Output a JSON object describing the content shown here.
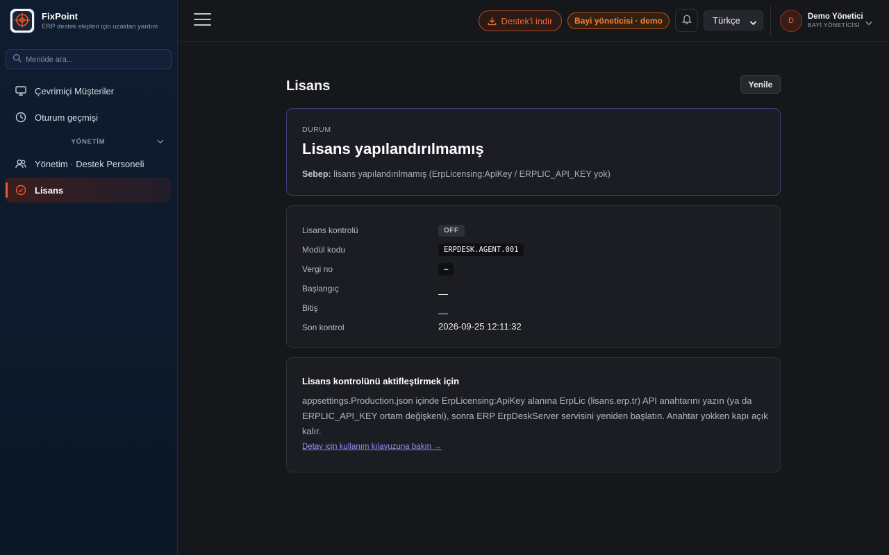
{
  "brand": {
    "name": "FixPoint",
    "tagline": "ERP destek ekipleri için uzaktan yardım"
  },
  "sidebar": {
    "search_placeholder": "Menüde ara...",
    "items": [
      {
        "label": "Çevrimiçi Müşteriler",
        "icon": "monitor-icon"
      },
      {
        "label": "Oturum geçmişi",
        "icon": "clock-icon"
      }
    ],
    "section": {
      "label": "YÖNETİM"
    },
    "admin_items": [
      {
        "label": "Yönetim · Destek Personeli",
        "icon": "users-icon"
      },
      {
        "label": "Lisans",
        "icon": "check-circle-icon",
        "active": true
      }
    ]
  },
  "topbar": {
    "download_label": "Destek'i indir",
    "role_label": "Bayi yöneticisi · demo",
    "language": "Türkçe",
    "user": {
      "initial": "D",
      "name": "Demo Yönetici",
      "role": "BAYİ YÖNETİCİSİ"
    }
  },
  "page": {
    "title": "Lisans",
    "refresh_label": "Yenile"
  },
  "status": {
    "label": "DURUM",
    "title": "Lisans yapılandırılmamış",
    "reason_label": "Sebep:",
    "reason_text": "lisans yapılandırılmamış (ErpLicensing:ApiKey / ERPLIC_API_KEY yok)"
  },
  "details": {
    "license_control_label": "Lisans kontrolü",
    "license_control_value": "OFF",
    "module_code_label": "Modül kodu",
    "module_code_value": "ERPDESK.AGENT.001",
    "tax_no_label": "Vergi no",
    "tax_no_value": "—",
    "start_label": "Başlangıç",
    "end_label": "Bitiş",
    "last_check_label": "Son kontrol",
    "last_check_value": "2026-09-25 12:11:32"
  },
  "info": {
    "title": "Lisans kontrolünü aktifleştirmek için",
    "body": "appsettings.Production.json içinde ErpLicensing:ApiKey alanına ErpLic (lisans.erp.tr) API anahtarını yazın (ya da ERPLIC_API_KEY ortam değişkeni), sonra ERP ErpDeskServer servisini yeniden başlatın. Anahtar yokken kapı açık kalır.",
    "link": "Detay için kullanım kılavuzuna bakın →"
  },
  "colors": {
    "accent": "#f05a28",
    "active_bg": "#3a1d1e",
    "status_border": "#3b3f78",
    "link": "#8d8ef0"
  }
}
